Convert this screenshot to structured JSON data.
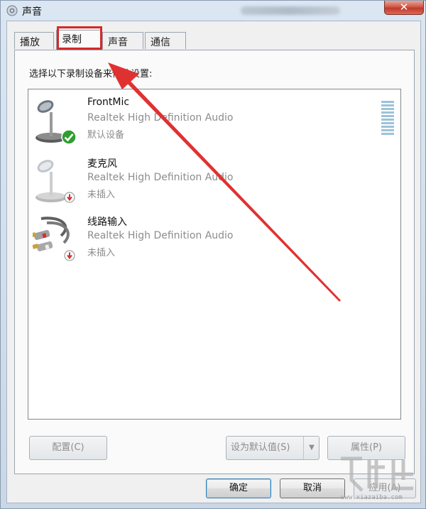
{
  "window": {
    "title": "声音",
    "close_label": "✕"
  },
  "tabs": [
    {
      "label": "播放",
      "active": false
    },
    {
      "label": "录制",
      "active": true
    },
    {
      "label": "声音",
      "active": false
    },
    {
      "label": "通信",
      "active": false
    }
  ],
  "panel": {
    "instruction": "选择以下录制设备来修改设置:"
  },
  "devices": [
    {
      "name": "FrontMic",
      "driver": "Realtek High Definition Audio",
      "status": "默认设备",
      "icon": "microphone-icon",
      "badge": "default-check-icon"
    },
    {
      "name": "麦克风",
      "driver": "Realtek High Definition Audio",
      "status": "未插入",
      "icon": "microphone-icon",
      "badge": "unplugged-icon"
    },
    {
      "name": "线路输入",
      "driver": "Realtek High Definition Audio",
      "status": "未插入",
      "icon": "line-in-cable-icon",
      "badge": "unplugged-icon"
    }
  ],
  "buttons": {
    "configure": "配置(C)",
    "set_default": "设为默认值(S)",
    "properties": "属性(P)",
    "ok": "确定",
    "cancel": "取消",
    "apply": "应用(A)"
  },
  "watermark": {
    "text": "www.xiazaiba.com"
  },
  "colors": {
    "highlight_red": "#d42a2a",
    "annotation_arrow": "#e03131",
    "check_green": "#2f9e2f"
  }
}
